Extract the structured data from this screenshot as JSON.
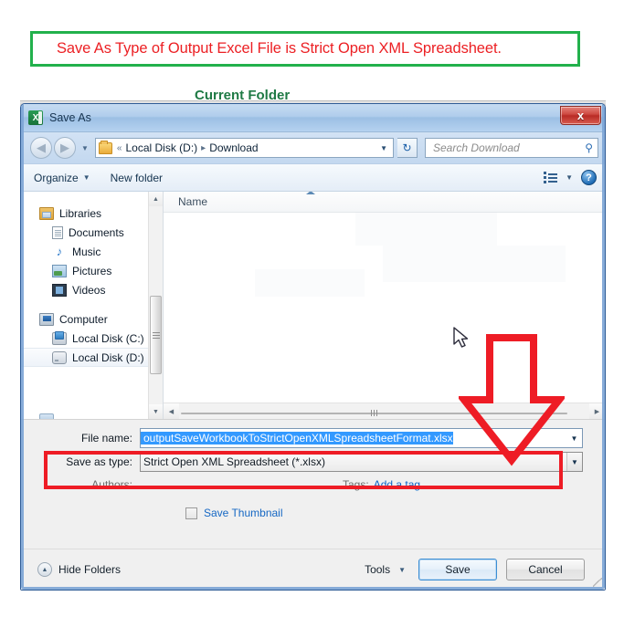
{
  "caption": {
    "text": "Save As Type of Output Excel File is Strict Open XML Spreadsheet.",
    "text_color": "#ec2024",
    "border_color": "#22b14c"
  },
  "background": {
    "label": "Current Folder",
    "label_color": "#1f7a45"
  },
  "dialog": {
    "title": "Save As",
    "app_icon": "excel-icon",
    "close_label": "x",
    "address": {
      "folder_icon": "folder-icon",
      "chevrons": "«",
      "crumbs": [
        "Local Disk (D:)",
        "Download"
      ],
      "separator": "▸",
      "dropdown_icon": "chevron-down-icon",
      "refresh_icon": "refresh-icon"
    },
    "search": {
      "placeholder": "Search Download",
      "icon": "search-icon"
    },
    "toolbar": {
      "organize_label": "Organize",
      "new_folder_label": "New folder",
      "view_icon": "list-view-icon",
      "view_caret_icon": "chevron-down-icon",
      "help_icon": "help-icon",
      "help_label": "?"
    },
    "nav_pane": {
      "items": [
        {
          "label": "Libraries",
          "icon": "library-icon",
          "level": 0,
          "selected": false
        },
        {
          "label": "Documents",
          "icon": "document-icon",
          "level": 1,
          "selected": false
        },
        {
          "label": "Music",
          "icon": "music-icon",
          "level": 1,
          "selected": false
        },
        {
          "label": "Pictures",
          "icon": "picture-icon",
          "level": 1,
          "selected": false
        },
        {
          "label": "Videos",
          "icon": "video-icon",
          "level": 1,
          "selected": false
        },
        {
          "label": "Computer",
          "icon": "computer-icon",
          "level": 0,
          "selected": false
        },
        {
          "label": "Local Disk (C:)",
          "icon": "hard-disk-icon",
          "level": 1,
          "selected": false
        },
        {
          "label": "Local Disk (D:)",
          "icon": "hard-disk-icon",
          "level": 1,
          "selected": true
        }
      ],
      "scroll_up_icon": "triangle-up-icon",
      "scroll_down_icon": "triangle-down-icon"
    },
    "file_list": {
      "column_header": "Name",
      "sort_indicator": "sort-ascending-icon",
      "rows": [],
      "scroll_left_icon": "triangle-left-icon",
      "scroll_right_icon": "triangle-right-icon"
    },
    "form": {
      "file_name_label": "File name:",
      "file_name_value": "outputSaveWorkbookToStrictOpenXMLSpreadsheetFormat.xlsx",
      "file_name_selected": true,
      "save_as_type_label": "Save as type:",
      "save_as_type_value": "Strict Open XML Spreadsheet (*.xlsx)",
      "authors_label": "Authors:",
      "authors_value": "",
      "tags_label": "Tags:",
      "tags_link": "Add a tag",
      "save_thumbnail_label": "Save Thumbnail",
      "save_thumbnail_checked": false
    },
    "footer": {
      "hide_folders_label": "Hide Folders",
      "hide_folders_icon": "triangle-up-circle-icon",
      "tools_label": "Tools",
      "tools_caret_icon": "chevron-down-icon",
      "save_label": "Save",
      "cancel_label": "Cancel"
    }
  },
  "annotations": {
    "highlight_box_color": "#ee1c25",
    "arrow_color": "#ee1c25",
    "arrow_direction": "down",
    "cursor": "arrow-cursor"
  }
}
